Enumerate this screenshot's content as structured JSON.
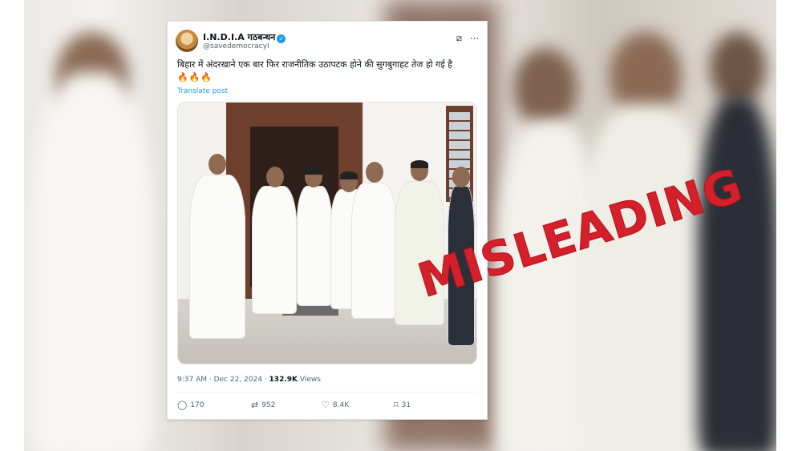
{
  "tweet": {
    "display_name": "I.N.D.I.A गठबन्धन",
    "handle": "@savedemocracyI",
    "text": "बिहार में अंदरखाने एक बार फिर राजनीतिक उठापटक होने की सुगबुगाहट तेज हो गई है",
    "emojis": "🔥🔥🔥",
    "translate_label": "Translate post",
    "time": "9:37 AM",
    "date": "Dec 22, 2024",
    "views_count": "132.9K",
    "views_label": "Views",
    "replies": "170",
    "reposts": "952",
    "likes": "8.4K",
    "bookmarks": "31"
  },
  "stamp": {
    "text": "MISLEADING",
    "color": "#d3202b"
  },
  "icons": {
    "verified": "verified-badge-icon",
    "grok": "grok-icon",
    "more": "more-options-icon",
    "reply": "reply-icon",
    "repost": "repost-icon",
    "like": "like-icon",
    "bookmark": "bookmark-icon"
  },
  "colors": {
    "link": "#1d9bf0",
    "text": "#0f1419",
    "muted": "#536471"
  }
}
